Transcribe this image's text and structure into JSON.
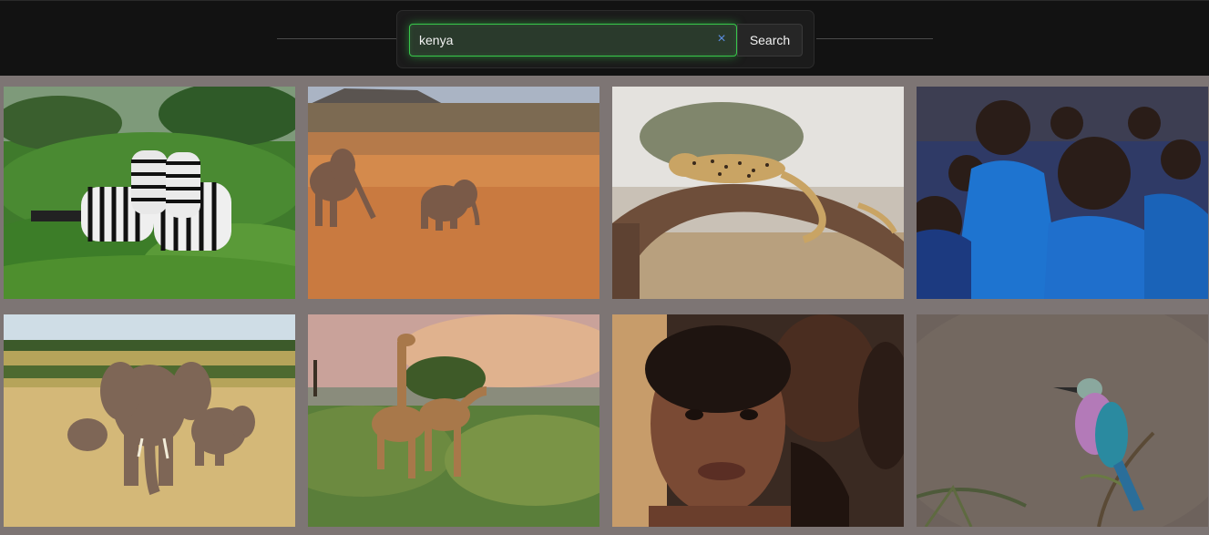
{
  "search": {
    "value": "kenya",
    "button_label": "Search",
    "clear_icon": "×"
  },
  "grid": {
    "images": [
      {
        "name": "zebras-image"
      },
      {
        "name": "elephants-running-image"
      },
      {
        "name": "leopard-on-branch-image"
      },
      {
        "name": "schoolchildren-image"
      },
      {
        "name": "elephant-herd-image"
      },
      {
        "name": "giraffes-image"
      },
      {
        "name": "child-portrait-image"
      },
      {
        "name": "lilac-breasted-roller-image"
      }
    ]
  }
}
